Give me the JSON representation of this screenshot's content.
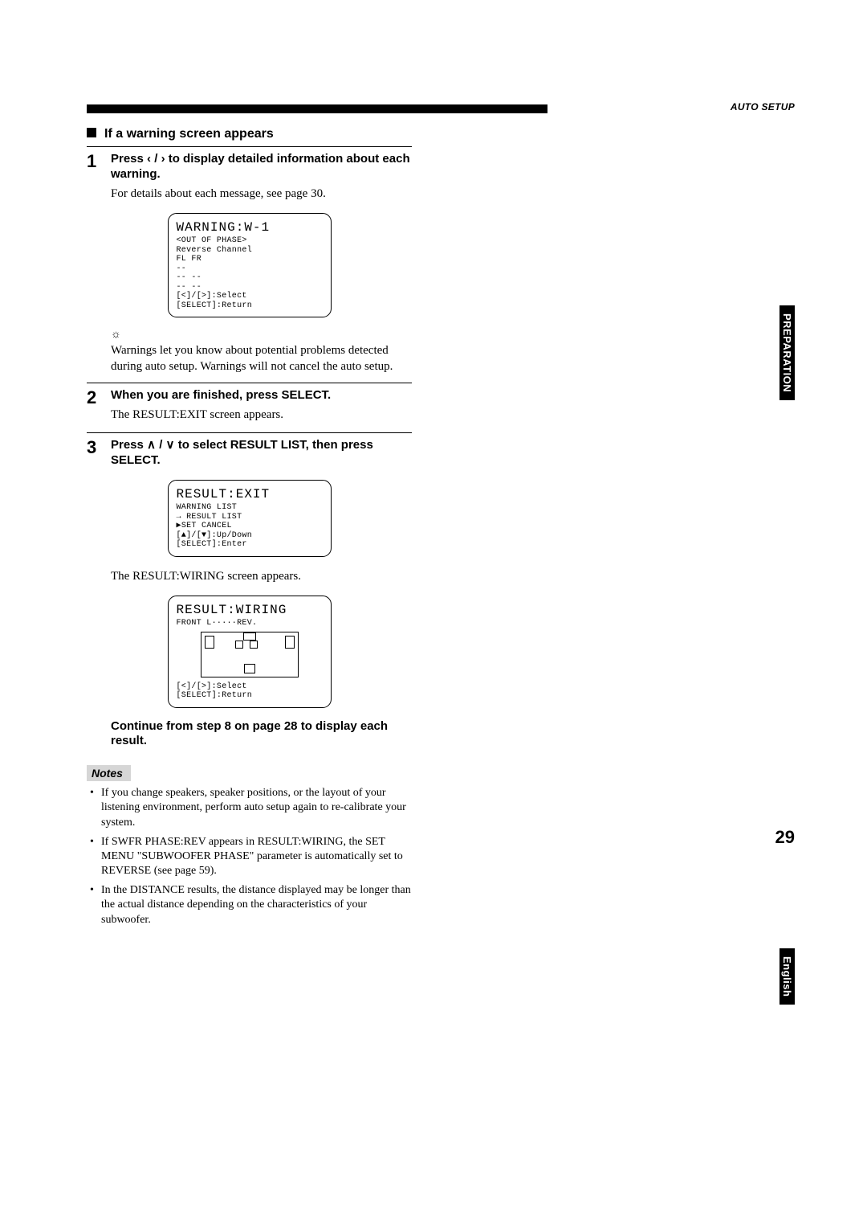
{
  "header_label": "AUTO SETUP",
  "section_title": "If a warning screen appears",
  "step1": {
    "num": "1",
    "head_a": "Press ",
    "head_b": " to display detailed information about each warning.",
    "plain": "For details about each message, see page 30."
  },
  "screen1": {
    "title": "WARNING:W-1",
    "l1": "<OUT OF PHASE>",
    "l2": "Reverse Channel",
    "l3": "FL    FR",
    "l4": "--",
    "l5": "--    --",
    "l6": "--    --",
    "l7": "[<]/[>]:Select",
    "l8": "[SELECT]:Return"
  },
  "tip": "Warnings let you know about potential problems detected during auto setup. Warnings will not cancel the auto setup.",
  "step2": {
    "num": "2",
    "head": "When you are finished, press SELECT.",
    "plain": "The RESULT:EXIT screen appears."
  },
  "step3": {
    "num": "3",
    "head_a": "Press ",
    "head_b": " to select RESULT LIST, then press SELECT."
  },
  "screen2": {
    "title": "RESULT:EXIT",
    "l1": "  WARNING LIST",
    "l2": "→ RESULT LIST",
    "l3": "",
    "l4": "  ▶SET    CANCEL",
    "l5": "  [▲]/[▼]:Up/Down",
    "l6": "  [SELECT]:Enter"
  },
  "after2": "The RESULT:WIRING screen appears.",
  "screen3": {
    "title": "RESULT:WIRING",
    "l1": "FRONT L·····REV.",
    "l2": "[<]/[>]:Select",
    "l3": "[SELECT]:Return"
  },
  "continue": "Continue from step 8 on page 28 to display each result.",
  "notes_label": "Notes",
  "notes": [
    "If you change speakers, speaker positions, or the layout of your listening environment, perform auto setup again to re-calibrate your system.",
    "If SWFR PHASE:REV appears in RESULT:WIRING, the SET MENU \"SUBWOOFER PHASE\" parameter is automatically set to REVERSE (see page 59).",
    "In the DISTANCE results, the distance displayed may be longer than the actual distance depending on the characteristics of your subwoofer."
  ],
  "side_prep": "PREPARATION",
  "side_eng": "English",
  "page_number": "29"
}
